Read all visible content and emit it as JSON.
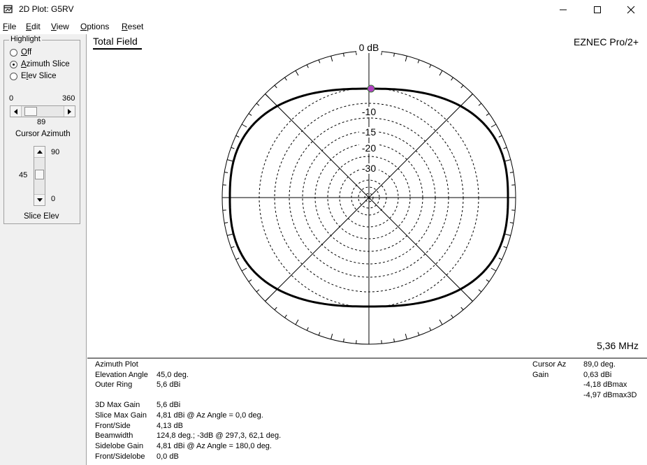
{
  "window": {
    "title": "2D Plot: G5RV"
  },
  "menu": [
    {
      "label": "File",
      "key": "F",
      "rest": "ile"
    },
    {
      "label": "Edit",
      "key": "E",
      "rest": "dit"
    },
    {
      "label": "View",
      "key": "V",
      "rest": "iew"
    },
    {
      "label": "Options",
      "key": "O",
      "rest": "ptions"
    },
    {
      "label": "Reset",
      "key": "R",
      "rest": "eset"
    }
  ],
  "highlight": {
    "group_label": "Highlight",
    "options": [
      {
        "key": "O",
        "rest": "ff",
        "checked": false
      },
      {
        "key": "A",
        "rest": "zimuth Slice",
        "checked": true
      },
      {
        "pre": "E",
        "key": "l",
        "rest": "ev Slice",
        "checked": false
      }
    ]
  },
  "azimuth_slider": {
    "min_label": "0",
    "max_label": "360",
    "value": "89",
    "caption": "Cursor Azimuth"
  },
  "elevation_slider": {
    "max_label": "90",
    "min_label": "0",
    "value": "45",
    "caption": "Slice Elev"
  },
  "plot": {
    "title": "Total Field",
    "brand": "EZNEC Pro/2+",
    "frequency": "5,36 MHz",
    "ring_labels": [
      "0 dB",
      "-10",
      "-15",
      "-20",
      "-30"
    ],
    "colors": {
      "pattern": "#000000",
      "cursor_marker": "#b040c0",
      "grid": "#000000"
    }
  },
  "info": {
    "left": [
      {
        "label": "Azimuth Plot",
        "value": ""
      },
      {
        "label": "Elevation Angle",
        "value": "45,0 deg."
      },
      {
        "label": "Outer Ring",
        "value": "5,6 dBi"
      },
      {
        "label": "3D Max Gain",
        "value": "5,6 dBi"
      },
      {
        "label": "Slice Max Gain",
        "value": "4,81 dBi @ Az Angle = 0,0 deg."
      },
      {
        "label": "Front/Side",
        "value": "4,13 dB"
      },
      {
        "label": "Beamwidth",
        "value": "124,8 deg.; -3dB @ 297,3, 62,1 deg."
      },
      {
        "label": "Sidelobe Gain",
        "value": "4,81 dBi @ Az Angle = 180,0 deg."
      },
      {
        "label": "Front/Sidelobe",
        "value": "0,0 dB"
      }
    ],
    "right": [
      {
        "label": "Cursor Az",
        "value": "89,0 deg."
      },
      {
        "label": "Gain",
        "value": "0,63 dBi"
      },
      {
        "label": "",
        "value": "-4,18 dBmax"
      },
      {
        "label": "",
        "value": "-4,97 dBmax3D"
      }
    ]
  }
}
